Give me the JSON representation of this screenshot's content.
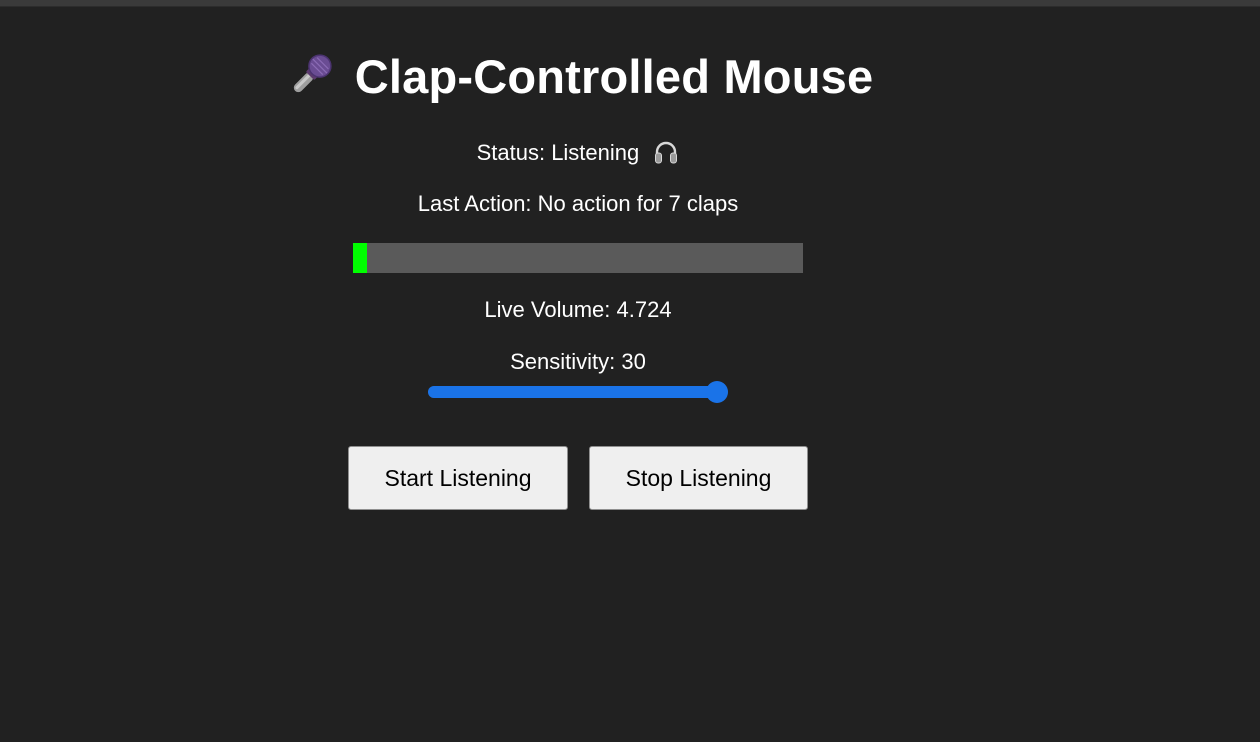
{
  "app": {
    "title": "Clap-Controlled Mouse",
    "title_icon": "microphone-icon"
  },
  "status": {
    "text": "Status: Listening",
    "icon": "headphones-icon"
  },
  "last_action": {
    "text": "Last Action: No action for 7 claps"
  },
  "volume_meter": {
    "level_fraction": 0.03,
    "fill_color": "#00ff00",
    "track_color": "#5a5a5a"
  },
  "live_volume": {
    "text": "Live Volume: 4.724"
  },
  "sensitivity": {
    "text": "Sensitivity: 30",
    "value": 30,
    "min": 0,
    "max": 30,
    "accent_color": "#1a73e8"
  },
  "buttons": {
    "start_label": "Start Listening",
    "stop_label": "Stop Listening"
  },
  "colors": {
    "background": "#212121",
    "text": "#ffffff",
    "button_bg": "#efefef"
  }
}
